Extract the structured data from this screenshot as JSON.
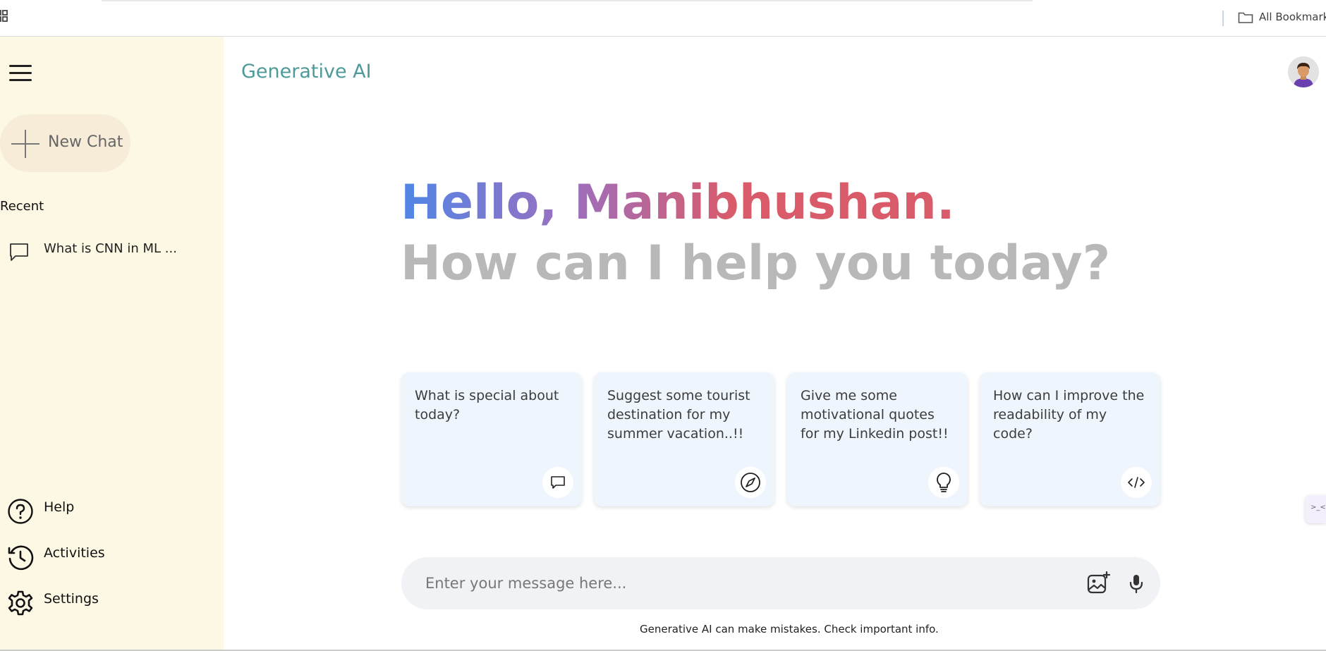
{
  "browser": {
    "bookmarks_label": "All Bookmarks"
  },
  "sidebar": {
    "new_chat_label": "New Chat",
    "recent_title": "Recent",
    "recent_items": [
      {
        "label": "What is CNN in ML ..."
      }
    ],
    "bottom_links": [
      {
        "label": "Help",
        "icon": "help-circle-icon"
      },
      {
        "label": "Activities",
        "icon": "history-icon"
      },
      {
        "label": "Settings",
        "icon": "gear-icon"
      }
    ]
  },
  "header": {
    "app_title": "Generative AI"
  },
  "greeting": {
    "hello": "Hello, Manibhushan.",
    "subtitle": "How can I help you today?"
  },
  "cards": [
    {
      "text": "What is special about today?",
      "icon": "chat-bubble-icon"
    },
    {
      "text": "Suggest some tourist destination for my summer vacation..!!",
      "icon": "compass-icon"
    },
    {
      "text": "Give me some motivational quotes for my Linkedin post!!",
      "icon": "lightbulb-icon"
    },
    {
      "text": "How can I improve the readability of my code?",
      "icon": "code-icon"
    }
  ],
  "input": {
    "placeholder": "Enter your message here..."
  },
  "footer": {
    "disclaimer": "Generative AI can make mistakes. Check important info."
  },
  "colors": {
    "sidebar_bg": "#fcf8e3",
    "title_color": "#4e9a9a",
    "card_bg": "#eef5fd",
    "greeting_gradient": [
      "#4f86e6",
      "#9b6fc0",
      "#d95b6a"
    ]
  }
}
